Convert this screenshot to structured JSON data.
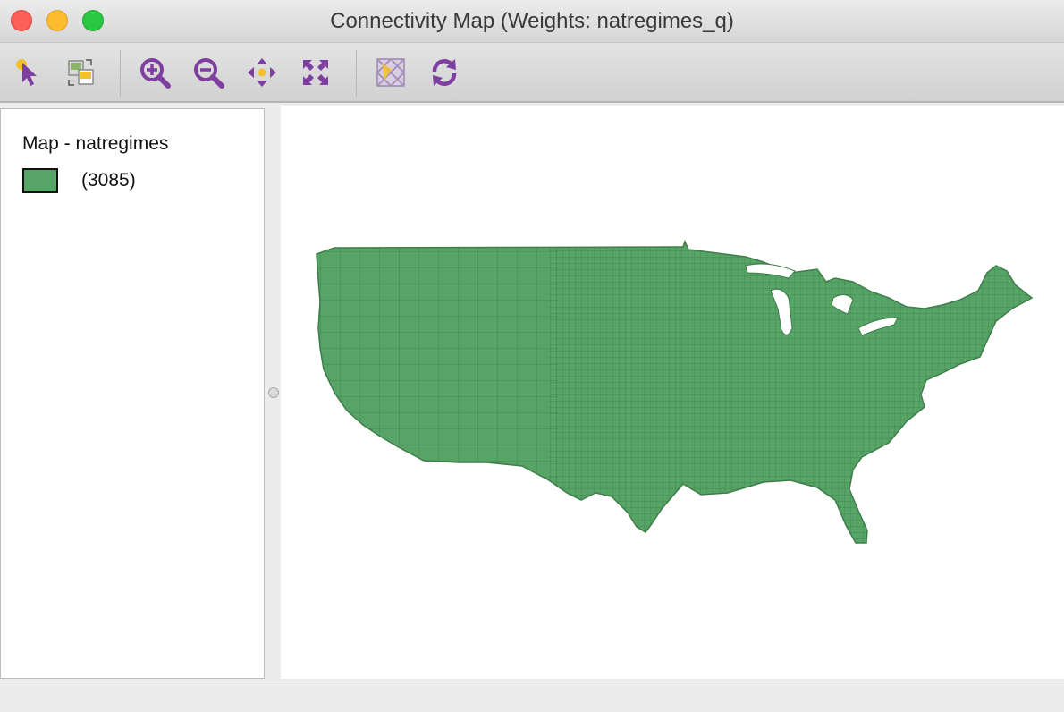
{
  "window": {
    "title": "Connectivity Map (Weights: natregimes_q)"
  },
  "toolbar": {
    "tools": [
      {
        "name": "select-icon"
      },
      {
        "name": "copy-image-icon"
      },
      {
        "name": "zoom-in-icon"
      },
      {
        "name": "zoom-out-icon"
      },
      {
        "name": "pan-icon"
      },
      {
        "name": "full-extent-icon"
      },
      {
        "name": "basemap-icon"
      },
      {
        "name": "refresh-icon"
      }
    ]
  },
  "legend": {
    "title": "Map - natregimes",
    "items": [
      {
        "label": "(3085)",
        "color": "#57a566"
      }
    ]
  },
  "colors": {
    "map_fill": "#57a566",
    "map_stroke": "#3f7d4b",
    "accent": "#7e3fa1"
  }
}
